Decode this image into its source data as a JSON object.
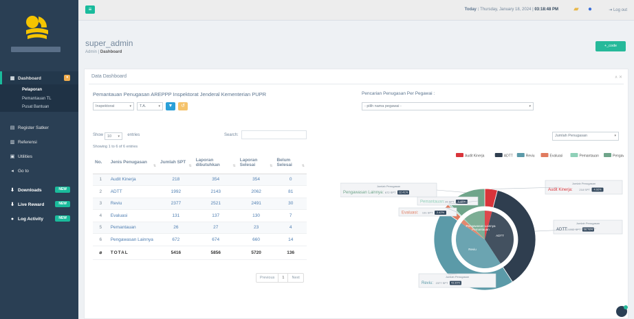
{
  "header": {
    "today_label": "Today :",
    "date_text": "Thursday, January 18, 2024",
    "time_text": "03:18:48 PM",
    "logout_label": "Log out"
  },
  "sidebar": {
    "items": [
      {
        "label": "Dashboard",
        "icon": "chart-icon",
        "badge": ""
      },
      {
        "label": "Register Satker",
        "icon": "grid-icon"
      },
      {
        "label": "Referensi",
        "icon": "table-icon"
      },
      {
        "label": "Utilities",
        "icon": "database-icon"
      },
      {
        "label": "Go to",
        "icon": "share-icon"
      },
      {
        "label": "Downloads",
        "icon": "download-icon",
        "badge": "NEW"
      },
      {
        "label": "Live Reward",
        "icon": "download-icon",
        "badge": "NEW"
      },
      {
        "label": "Log Activity",
        "icon": "bullet-icon",
        "badge": "NEW"
      }
    ],
    "submenu": [
      "Pelaporan",
      "Pemantauan TL",
      "Pusat Bantuan"
    ]
  },
  "page": {
    "title": "super_admin",
    "breadcrumb_root": "Admin",
    "breadcrumb_sep": "|",
    "breadcrumb_current": "Dashboard",
    "code_button": "+_code"
  },
  "panel": {
    "title": "Data Dashboard",
    "tools": "∧ ✕",
    "left_title": "Pemantauan Penugasan AREPPP Inspektorat Jenderal Kementerian PUPR",
    "right_title": "Pencarian Penugasan Per Pegawai :",
    "filter_unit": "Inspektorat",
    "filter_year": "T.A.",
    "pegawai_placeholder": "- pilih nama pegawai -",
    "show_label": "Show",
    "entries_value": "10",
    "entries_label": "entries",
    "search_label": "Search:",
    "showing_text": "Showing 1 to 6 of 6 entries",
    "chart_select": "Jumlah Penugasan",
    "pager": {
      "prev": "Previous",
      "page": "1",
      "next": "Next"
    }
  },
  "table": {
    "headers": [
      "No.",
      "Jenis Penugasan",
      "Jumlah SPT",
      "Laporan dibutuhkan",
      "Laporan Selesai",
      "Belum Selesai"
    ],
    "rows": [
      {
        "no": "1",
        "jenis": "Audit Kinerja",
        "spt": "218",
        "butuh": "354",
        "selesai": "354",
        "belum": "0"
      },
      {
        "no": "2",
        "jenis": "ADTT",
        "spt": "1992",
        "butuh": "2143",
        "selesai": "2062",
        "belum": "81"
      },
      {
        "no": "3",
        "jenis": "Reviu",
        "spt": "2377",
        "butuh": "2521",
        "selesai": "2491",
        "belum": "30"
      },
      {
        "no": "4",
        "jenis": "Evaluasi",
        "spt": "131",
        "butuh": "137",
        "selesai": "130",
        "belum": "7"
      },
      {
        "no": "5",
        "jenis": "Pemantauan",
        "spt": "26",
        "butuh": "27",
        "selesai": "23",
        "belum": "4"
      },
      {
        "no": "6",
        "jenis": "Pengawasan Lainnya",
        "spt": "672",
        "butuh": "674",
        "selesai": "660",
        "belum": "14"
      }
    ],
    "total": {
      "label": "TOTAL",
      "spt": "5416",
      "butuh": "5856",
      "selesai": "5720",
      "belum": "136"
    }
  },
  "chart_data": {
    "type": "pie",
    "categories": [
      "Audit Kinerja",
      "ADTT",
      "Reviu",
      "Evaluasi",
      "Pemantauan",
      "Pengawasan Lainnya"
    ],
    "values": [
      218,
      1992,
      2377,
      131,
      26,
      672
    ],
    "percent_labels": [
      "4.02%",
      "36.78%",
      "43.89%",
      "2.42%",
      "0.48%",
      "12.41%"
    ],
    "colors": [
      "#d9343a",
      "#2f3e4f",
      "#5b9aa8",
      "#e07b5f",
      "#8fd0b8",
      "#6fa58a"
    ],
    "inner_labels": [
      "Pengawasan Lainnya",
      "Pemantauan",
      "ADTT",
      "Reviu"
    ],
    "callout_title": "Jumlah Penugasan",
    "spt_unit": "SPT",
    "legend_position": "top"
  }
}
